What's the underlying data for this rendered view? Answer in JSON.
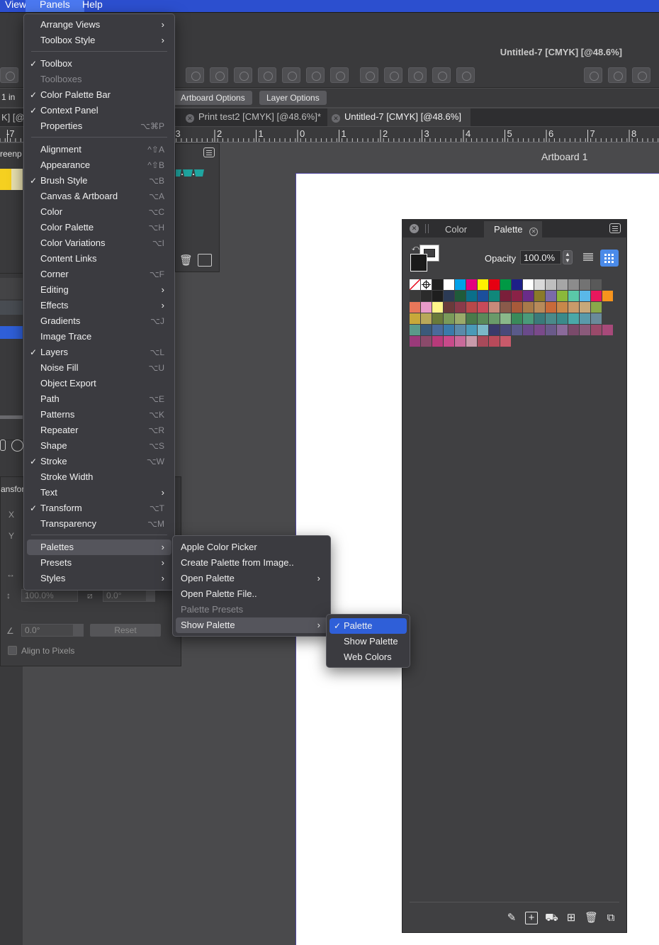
{
  "menubar": {
    "view": "View",
    "panels": "Panels",
    "help": "Help"
  },
  "window": {
    "title": "Untitled-7 [CMYK] [@48.6%]"
  },
  "context_bar": {
    "artboard_options": "Artboard Options",
    "layer_options": "Layer Options"
  },
  "tabs": [
    {
      "label": "Print test2 [CMYK] [@48.6%]*"
    },
    {
      "label": "Untitled-7 [CMYK] [@48.6%]"
    }
  ],
  "ruler": {
    "numbers": [
      "3",
      "2",
      "1",
      "0",
      "1",
      "2",
      "3",
      "4",
      "5",
      "6",
      "7",
      "8"
    ],
    "left_numbers": [
      "-7"
    ]
  },
  "artboard": {
    "label": "Artboard 1"
  },
  "left_panel": {
    "unit": "1 in",
    "greenp": "reenp",
    "transform": "ansfor",
    "x": "X",
    "y": "Y",
    "scale": "100.0%",
    "skew": "0.0°",
    "rotation": "0.0°",
    "reset": "Reset",
    "align_to_pixels": "Align to Pixels",
    "cmyk_partial": "K] [@"
  },
  "main_menu": {
    "items": [
      {
        "label": "Arrange Views",
        "check": false,
        "shortcut": "",
        "submenu": true,
        "disabled": false
      },
      {
        "label": "Toolbox Style",
        "check": false,
        "shortcut": "",
        "submenu": true,
        "disabled": false
      },
      {
        "label": "Toolbox",
        "check": true,
        "shortcut": "",
        "submenu": false,
        "disabled": false
      },
      {
        "label": "Toolboxes",
        "check": false,
        "shortcut": "",
        "submenu": false,
        "disabled": true
      },
      {
        "label": "Color Palette Bar",
        "check": true,
        "shortcut": "",
        "submenu": false,
        "disabled": false
      },
      {
        "label": "Context Panel",
        "check": true,
        "shortcut": "",
        "submenu": false,
        "disabled": false
      },
      {
        "label": "Properties",
        "check": false,
        "shortcut": "⌥⌘P",
        "submenu": false,
        "disabled": false
      },
      {
        "label": "Alignment",
        "check": false,
        "shortcut": "^⇧A",
        "submenu": false,
        "disabled": false
      },
      {
        "label": "Appearance",
        "check": false,
        "shortcut": "^⇧B",
        "submenu": false,
        "disabled": false
      },
      {
        "label": "Brush Style",
        "check": true,
        "shortcut": "⌥B",
        "submenu": false,
        "disabled": false
      },
      {
        "label": "Canvas & Artboard",
        "check": false,
        "shortcut": "⌥A",
        "submenu": false,
        "disabled": false
      },
      {
        "label": "Color",
        "check": false,
        "shortcut": "⌥C",
        "submenu": false,
        "disabled": false
      },
      {
        "label": "Color Palette",
        "check": false,
        "shortcut": "⌥H",
        "submenu": false,
        "disabled": false
      },
      {
        "label": "Color Variations",
        "check": false,
        "shortcut": "⌥I",
        "submenu": false,
        "disabled": false
      },
      {
        "label": "Content Links",
        "check": false,
        "shortcut": "",
        "submenu": false,
        "disabled": false
      },
      {
        "label": "Corner",
        "check": false,
        "shortcut": "⌥F",
        "submenu": false,
        "disabled": false
      },
      {
        "label": "Editing",
        "check": false,
        "shortcut": "",
        "submenu": true,
        "disabled": false
      },
      {
        "label": "Effects",
        "check": false,
        "shortcut": "",
        "submenu": true,
        "disabled": false
      },
      {
        "label": "Gradients",
        "check": false,
        "shortcut": "⌥J",
        "submenu": false,
        "disabled": false
      },
      {
        "label": "Image Trace",
        "check": false,
        "shortcut": "",
        "submenu": false,
        "disabled": false
      },
      {
        "label": "Layers",
        "check": true,
        "shortcut": "⌥L",
        "submenu": false,
        "disabled": false
      },
      {
        "label": "Noise Fill",
        "check": false,
        "shortcut": "⌥U",
        "submenu": false,
        "disabled": false
      },
      {
        "label": "Object Export",
        "check": false,
        "shortcut": "",
        "submenu": false,
        "disabled": false
      },
      {
        "label": "Path",
        "check": false,
        "shortcut": "⌥E",
        "submenu": false,
        "disabled": false
      },
      {
        "label": "Patterns",
        "check": false,
        "shortcut": "⌥K",
        "submenu": false,
        "disabled": false
      },
      {
        "label": "Repeater",
        "check": false,
        "shortcut": "⌥R",
        "submenu": false,
        "disabled": false
      },
      {
        "label": "Shape",
        "check": false,
        "shortcut": "⌥S",
        "submenu": false,
        "disabled": false
      },
      {
        "label": "Stroke",
        "check": true,
        "shortcut": "⌥W",
        "submenu": false,
        "disabled": false
      },
      {
        "label": "Stroke Width",
        "check": false,
        "shortcut": "",
        "submenu": false,
        "disabled": false
      },
      {
        "label": "Text",
        "check": false,
        "shortcut": "",
        "submenu": true,
        "disabled": false
      },
      {
        "label": "Transform",
        "check": true,
        "shortcut": "⌥T",
        "submenu": false,
        "disabled": false
      },
      {
        "label": "Transparency",
        "check": false,
        "shortcut": "⌥M",
        "submenu": false,
        "disabled": false
      },
      {
        "label": "Palettes",
        "check": false,
        "shortcut": "",
        "submenu": true,
        "disabled": false,
        "highlighted": true
      },
      {
        "label": "Presets",
        "check": false,
        "shortcut": "",
        "submenu": true,
        "disabled": false
      },
      {
        "label": "Styles",
        "check": false,
        "shortcut": "",
        "submenu": true,
        "disabled": false
      }
    ]
  },
  "palettes_submenu": {
    "items": [
      {
        "label": "Apple Color Picker",
        "submenu": false,
        "disabled": false
      },
      {
        "label": "Create Palette from Image..",
        "submenu": false,
        "disabled": false
      },
      {
        "label": "Open Palette",
        "submenu": true,
        "disabled": false
      },
      {
        "label": "Open Palette File..",
        "submenu": false,
        "disabled": false
      },
      {
        "label": "Palette Presets",
        "submenu": false,
        "disabled": true
      },
      {
        "label": "Show Palette",
        "submenu": true,
        "disabled": false,
        "highlighted": true
      }
    ]
  },
  "show_palette_submenu": {
    "items": [
      {
        "label": "Palette",
        "check": true,
        "selected": true
      },
      {
        "label": "Show Palette",
        "check": false,
        "selected": false
      },
      {
        "label": "Web Colors",
        "check": false,
        "selected": false
      }
    ]
  },
  "palette_panel": {
    "tab_color": "Color",
    "tab_palette": "Palette",
    "opacity_label": "Opacity",
    "opacity_value": "100.0%",
    "swatch_rows": [
      [
        "none",
        "reg",
        "#1f1f1f",
        "#ffffff",
        "#00a0e9",
        "#e4007f",
        "#fff100",
        "#e60012",
        "#009944",
        "#1d2088",
        "#ffffff",
        "#d9d9d9",
        "#bfbfbf",
        "#a6a6a6",
        "#8c8c8c",
        "#737373",
        "#595959"
      ],
      [
        "#3a3a3a",
        "#2b2b2b",
        "#1e1e1e",
        "#2b3a55",
        "#1f5b3a",
        "#0a6f8a",
        "#1b4f9c",
        "#10877a",
        "#7a1f3a",
        "#8a2247",
        "#6a2c8a",
        "#8a7a2a",
        "#7a6aa8",
        "#8ab83a",
        "#5ac8a8",
        "#5ab8e8",
        "#e8175d",
        "#f7941d"
      ],
      [
        "#e8775a",
        "#e89ac8",
        "#fff48a",
        "#6a3a3a",
        "#8a3a4a",
        "#b8484a",
        "#c84a5a",
        "#c88a7a",
        "#8a5a4a",
        "#a85a3a",
        "#a87a4a",
        "#b88a5a",
        "#c86a3a",
        "#c8884a",
        "#c89a6a",
        "#c8a87a",
        "#8aa84a"
      ],
      [
        "#c8a83a",
        "#b8a85a",
        "#6a7a3a",
        "#7a9a5a",
        "#9aaa6a",
        "#4a7a4a",
        "#5a8a5a",
        "#6a9a6a",
        "#8ab88a",
        "#3a8a5a",
        "#4a9a7a",
        "#3a7a7a",
        "#4a8a8a",
        "#3a8a8a",
        "#4aa8a8",
        "#5a9aaa",
        "#6a8a9a"
      ],
      [
        "#5a9a8a",
        "#3a5a7a",
        "#4a6a9a",
        "#3a7aaa",
        "#5a8aaa",
        "#4a9ab8",
        "#7ab8c8",
        "#3a3a6a",
        "#4a4a7a",
        "#5a5a8a",
        "#6a4a8a",
        "#7a4a8a",
        "#6a5a8a",
        "#8a6a9a",
        "#7a4a6a",
        "#8a5a7a",
        "#9a4a6a",
        "#a84a7a"
      ],
      [
        "#9a3a7a",
        "#8a4a6a",
        "#b83a7a",
        "#c84a8a",
        "#c86a9a",
        "#c89aaa",
        "#a84a5a",
        "#b84a5a",
        "#c85a6a"
      ]
    ]
  },
  "colors": {
    "menubar": "#2c4fcf",
    "selection": "#2f5fd8",
    "menu_bg": "#3b3b40",
    "artboard_border": "#5048a0"
  }
}
